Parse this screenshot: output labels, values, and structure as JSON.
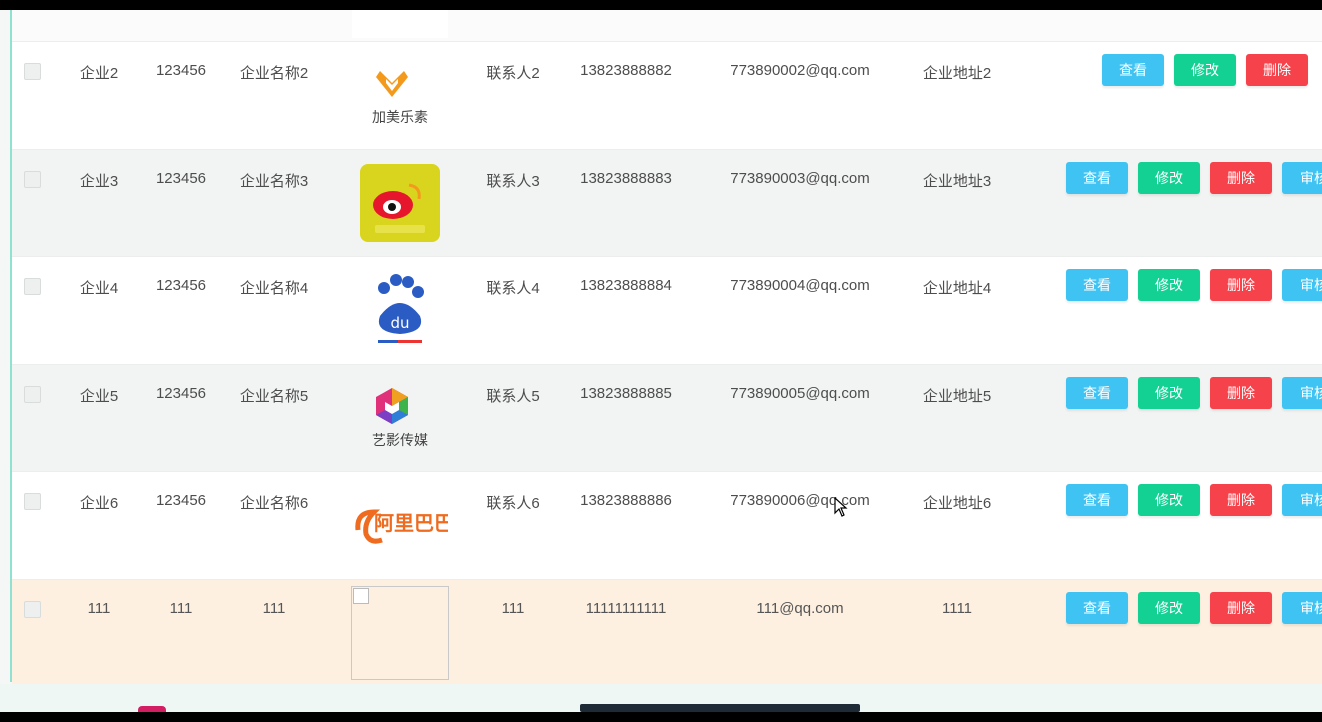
{
  "table": {
    "rows": [
      {
        "name": "企业2",
        "code": "123456",
        "full_name": "企业名称2",
        "logo": "jiamei-logo",
        "logo_text": "加美乐素",
        "contact": "联系人2",
        "phone": "13823888882",
        "email": "773890002@qq.com",
        "address": "企业地址2",
        "actions": [
          "查看",
          "修改",
          "删除"
        ]
      },
      {
        "name": "企业3",
        "code": "123456",
        "full_name": "企业名称3",
        "logo": "weibo-logo",
        "contact": "联系人3",
        "phone": "13823888883",
        "email": "773890003@qq.com",
        "address": "企业地址3",
        "actions": [
          "查看",
          "修改",
          "删除",
          "审核"
        ]
      },
      {
        "name": "企业4",
        "code": "123456",
        "full_name": "企业名称4",
        "logo": "baidu-logo",
        "logo_text": "du",
        "contact": "联系人4",
        "phone": "13823888884",
        "email": "773890004@qq.com",
        "address": "企业地址4",
        "actions": [
          "查看",
          "修改",
          "删除",
          "审核"
        ]
      },
      {
        "name": "企业5",
        "code": "123456",
        "full_name": "企业名称5",
        "logo": "yiying-logo",
        "logo_text": "艺影传媒",
        "contact": "联系人5",
        "phone": "13823888885",
        "email": "773890005@qq.com",
        "address": "企业地址5",
        "actions": [
          "查看",
          "修改",
          "删除",
          "审核"
        ]
      },
      {
        "name": "企业6",
        "code": "123456",
        "full_name": "企业名称6",
        "logo": "alibaba-logo",
        "logo_text": "阿里巴巴",
        "contact": "联系人6",
        "phone": "13823888886",
        "email": "773890006@qq.com",
        "address": "企业地址6",
        "actions": [
          "查看",
          "修改",
          "删除",
          "审核"
        ]
      },
      {
        "name": "111",
        "code": "111",
        "full_name": "111",
        "logo": "broken-image",
        "contact": "111",
        "phone": "11111111111",
        "email": "111@qq.com",
        "address": "1111",
        "actions": [
          "查看",
          "修改",
          "删除",
          "审核"
        ]
      }
    ]
  },
  "colors": {
    "view_button": "#3fc3f3",
    "edit_button": "#13d193",
    "delete_button": "#f6424b",
    "highlight_row": "#fdf0e1",
    "accent_border": "#8fe1d0"
  }
}
